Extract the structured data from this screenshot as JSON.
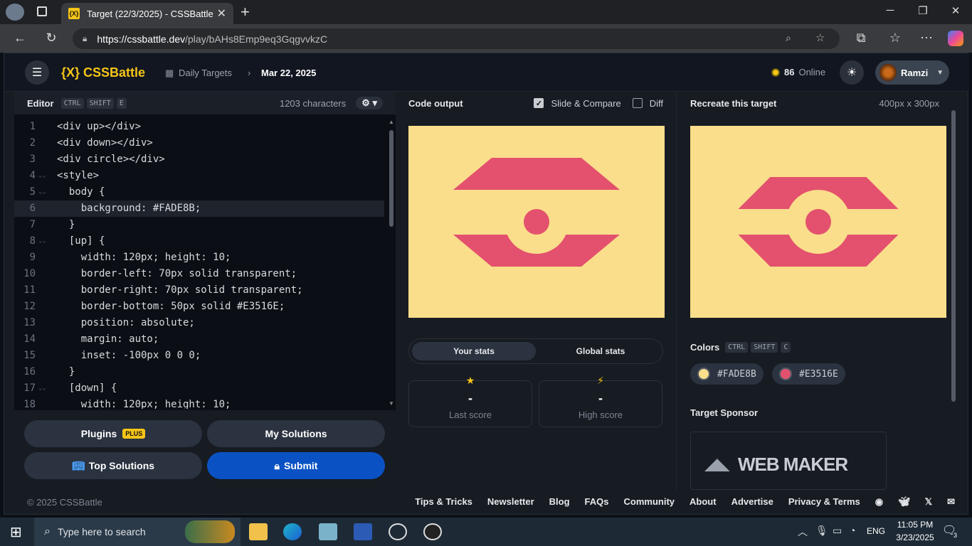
{
  "browser": {
    "tab_title": "Target (22/3/2025) - CSSBattle",
    "tab_icon": "{X}",
    "url_host": "https://cssbattle.dev",
    "url_path": "/play/bAHs8Emp9eq3GqgvvkzC"
  },
  "header": {
    "logo": "{X} CSSBattle",
    "crumb_parent": "Daily Targets",
    "crumb_current": "Mar 22, 2025",
    "online_count": "86",
    "online_label": "Online",
    "username": "Ramzi"
  },
  "editor": {
    "title": "Editor",
    "shortcut": [
      "CTRL",
      "SHIFT",
      "E"
    ],
    "char_count": "1203 characters",
    "lines": [
      "<div up></div>",
      "<div down></div>",
      "<div circle></div>",
      "<style>",
      "  body {",
      "    background: #FADE8B;",
      "  }",
      "  [up] {",
      "    width: 120px; height: 10;",
      "    border-left: 70px solid transparent;",
      "    border-right: 70px solid transparent;",
      "    border-bottom: 50px solid #E3516E;",
      "    position: absolute;",
      "    margin: auto;",
      "    inset: -100px 0 0 0;",
      "  }",
      "  [down] {",
      "    width: 120px; height: 10;"
    ],
    "buttons": {
      "plugins": "Plugins",
      "plugins_badge": "PLUS",
      "my_solutions": "My Solutions",
      "top_solutions": "Top Solutions",
      "submit": "Submit"
    }
  },
  "output": {
    "title": "Code output",
    "slide_compare": "Slide & Compare",
    "diff": "Diff",
    "tabs": [
      "Your stats",
      "Global stats"
    ],
    "last_score_value": "-",
    "last_score_label": "Last score",
    "high_score_value": "-",
    "high_score_label": "High score"
  },
  "target": {
    "title": "Recreate this target",
    "size": "400px x 300px",
    "colors_title": "Colors",
    "colors_shortcut": [
      "CTRL",
      "SHIFT",
      "C"
    ],
    "colors": [
      "#FADE8B",
      "#E3516E"
    ],
    "sponsor_title": "Target Sponsor",
    "sponsor_name": "WEB MAKER"
  },
  "footer": {
    "copyright": "© 2025 CSSBattle",
    "links": [
      "Tips & Tricks",
      "Newsletter",
      "Blog",
      "FAQs",
      "Community",
      "About",
      "Advertise",
      "Privacy & Terms"
    ]
  },
  "taskbar": {
    "search_placeholder": "Type here to search",
    "lang": "ENG",
    "time": "11:05 PM",
    "date": "3/23/2025",
    "notif_count": "3"
  }
}
